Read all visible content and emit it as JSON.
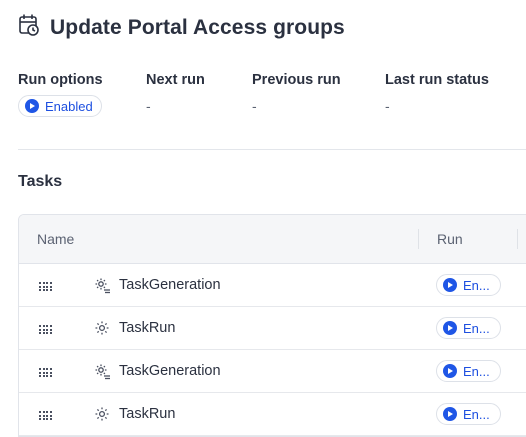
{
  "header": {
    "title": "Update Portal Access groups",
    "icon": "calendar-clock-icon"
  },
  "meta": {
    "run_options": {
      "label": "Run options",
      "value": "Enabled"
    },
    "next_run": {
      "label": "Next run",
      "value": "-"
    },
    "previous_run": {
      "label": "Previous run",
      "value": "-"
    },
    "last_run_status": {
      "label": "Last run status",
      "value": "-"
    }
  },
  "tasks": {
    "title": "Tasks",
    "columns": {
      "name": "Name",
      "run": "Run"
    },
    "rows": [
      {
        "name": "TaskGeneration",
        "icon": "gear-list-icon",
        "run": "En..."
      },
      {
        "name": "TaskRun",
        "icon": "gear-icon",
        "run": "En..."
      },
      {
        "name": "TaskGeneration",
        "icon": "gear-list-icon",
        "run": "En..."
      },
      {
        "name": "TaskRun",
        "icon": "gear-icon",
        "run": "En..."
      }
    ]
  },
  "colors": {
    "accent": "#1f56e6",
    "text": "#2b3140",
    "muted": "#5b6272"
  }
}
